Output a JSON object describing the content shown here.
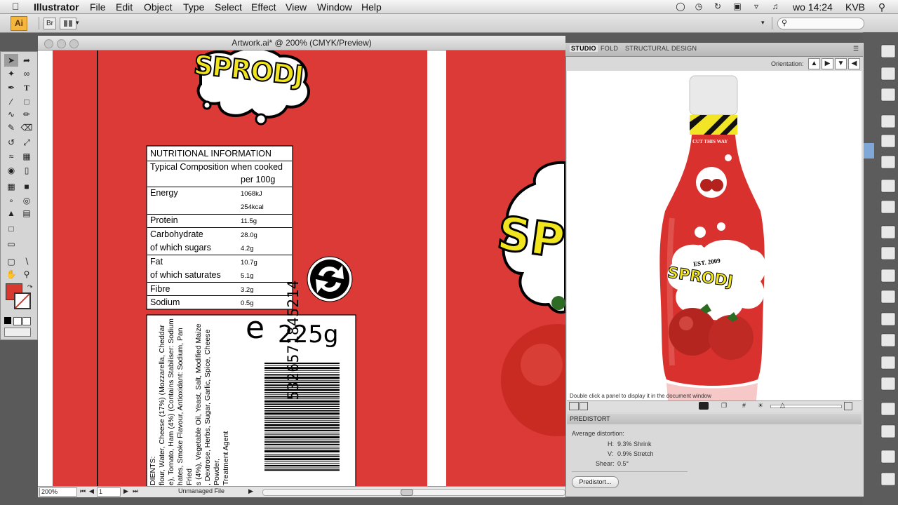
{
  "menubar": {
    "app_name": "Illustrator",
    "items": [
      "File",
      "Edit",
      "Object",
      "Type",
      "Select",
      "Effect",
      "View",
      "Window",
      "Help"
    ],
    "clock": "wo 14:24",
    "user": "KVB"
  },
  "control_bar": {
    "logo": "Ai"
  },
  "document": {
    "title": "Artwork.ai* @ 200% (CMYK/Preview)",
    "zoom": "200%",
    "page": "1",
    "status": "Unmanaged File"
  },
  "artwork": {
    "brand": "SPRODJ",
    "brand_partial": "SP",
    "nutrition": {
      "title": "NUTRITIONAL INFORMATION",
      "composition_line1": "Typical Composition when cooked",
      "composition_line2": "per 100g",
      "rows": [
        {
          "label": "Energy",
          "value": "1068kJ"
        },
        {
          "label": "",
          "value": "254kcal"
        },
        {
          "label": "Protein",
          "value": "11.5g"
        },
        {
          "label": "Carbohydrate",
          "value": "28.0g"
        },
        {
          "label": "of which sugars",
          "value": "4.2g"
        },
        {
          "label": "Fat",
          "value": "10.7g"
        },
        {
          "label": "of which saturates",
          "value": "5.1g"
        },
        {
          "label": "Fibre",
          "value": "3.2g"
        },
        {
          "label": "Sodium",
          "value": "0.5g"
        }
      ]
    },
    "weight_mark": "e",
    "weight": "225g",
    "barcode_number": "5326571845214",
    "ingredients_lines": [
      "DIENTS:",
      "flour, Water, Cheese (17%) (Mozzarella, Cheddar",
      "e), Tomato, Ham (4%) (Contains Stabiliser: Sodium",
      "hates, Smoke Flavour, Antioxidant: Sodium, Pan Fried",
      "s (4%), Vegetable Oil, Yeast, Salt, Modified Maize",
      ", Dextrose, Herbs, Sugar, Garlic, Spice, Cheese Powder,",
      "Treatment Agent"
    ]
  },
  "studio": {
    "tabs": [
      "STUDIO",
      "FOLD",
      "STRUCTURAL DESIGN"
    ],
    "orientation_label": "Orientation:",
    "bottle_band_text": "CUT THIS WAY",
    "bottle_est": "EST. 2009",
    "bottle_brand": "SPRODJ",
    "hint": "Double click a panel to display it in the document window",
    "predistort": {
      "header": "PREDISTORT",
      "average_label": "Average distortion:",
      "h_label": "H:",
      "h_value": "9.3% Shrink",
      "v_label": "V:",
      "v_value": "0.9% Stretch",
      "shear_label": "Shear:",
      "shear_value": "0.5°",
      "button": "Predistort..."
    }
  },
  "colors": {
    "package_red": "#dc3a36",
    "brand_yellow": "#f1e51f",
    "ai_orange": "#f6b63c"
  },
  "icons": [
    "apple-icon",
    "search-icon",
    "selection-tool-icon",
    "pen-tool-icon",
    "type-tool-icon",
    "recycle-icon",
    "tomato-image"
  ]
}
